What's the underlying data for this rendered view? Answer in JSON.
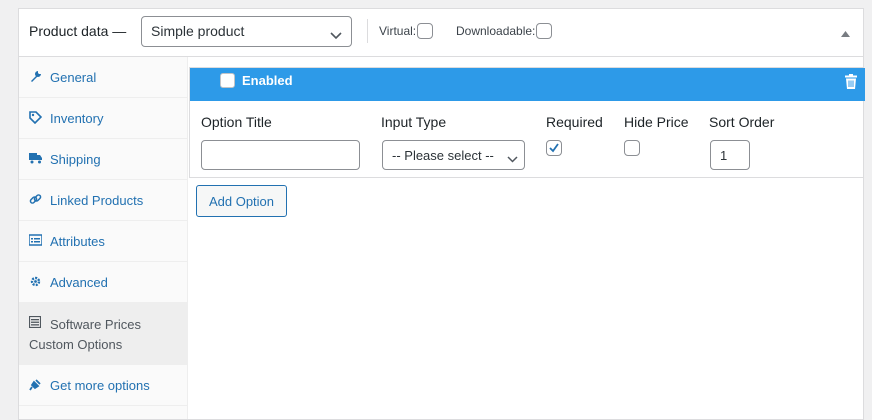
{
  "header": {
    "title": "Product data —",
    "product_type": "Simple product",
    "virtual_label": "Virtual:",
    "downloadable_label": "Downloadable:"
  },
  "tabs": [
    {
      "label": "General",
      "icon": "wrench-icon"
    },
    {
      "label": "Inventory",
      "icon": "tag-icon"
    },
    {
      "label": "Shipping",
      "icon": "truck-icon"
    },
    {
      "label": "Linked Products",
      "icon": "link-icon"
    },
    {
      "label": "Attributes",
      "icon": "list-icon"
    },
    {
      "label": "Advanced",
      "icon": "gear-icon"
    },
    {
      "label": "Software Prices Custom Options",
      "icon": "table-icon",
      "active": true
    },
    {
      "label": "Get more options",
      "icon": "plugin-icon"
    }
  ],
  "option": {
    "enabled_label": "Enabled",
    "columns": {
      "option_title": "Option Title",
      "input_type": "Input Type",
      "required": "Required",
      "hide_price": "Hide Price",
      "sort_order": "Sort Order"
    },
    "title_value": "",
    "input_type_value": "-- Please select --",
    "required_checked": true,
    "hide_price_checked": false,
    "sort_order_value": "1"
  },
  "add_option_label": "Add Option",
  "colors": {
    "accent": "#2271b1",
    "option_bar": "#2d9ae8"
  }
}
